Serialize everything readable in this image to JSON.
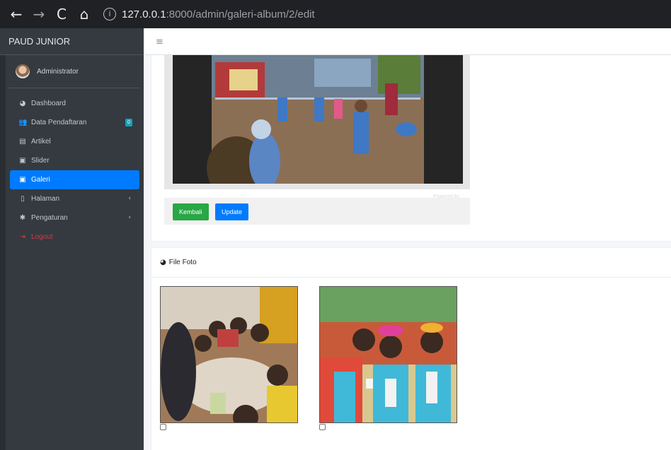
{
  "browser": {
    "back": "←",
    "forward": "→",
    "reload": "C",
    "home": "⌂",
    "info": "i",
    "url_host": "127.0.0.1",
    "url_path": ":8000/admin/galeri-album/2/edit"
  },
  "sidebar": {
    "brand": "PAUD JUNIOR",
    "user": "Administrator",
    "items": [
      {
        "label": "Dashboard",
        "icon": "tachometer-icon"
      },
      {
        "label": "Data Pendaftaran",
        "icon": "users-icon",
        "badge": "0"
      },
      {
        "label": "Artikel",
        "icon": "newspaper-icon"
      },
      {
        "label": "Slider",
        "icon": "images-icon"
      },
      {
        "label": "Galeri",
        "icon": "images-icon",
        "active": true
      },
      {
        "label": "Halaman",
        "icon": "file-icon",
        "chevron": "‹"
      },
      {
        "label": "Pengaturan",
        "icon": "cog-icon",
        "chevron": "‹"
      },
      {
        "label": "Logout",
        "icon": "sign-out-icon",
        "color": "#dc3545"
      }
    ]
  },
  "topbar": {
    "menu_icon": "≡"
  },
  "editor": {
    "powered_by": "Powered by FQINA",
    "back_label": "Kembali",
    "update_label": "Update"
  },
  "files": {
    "title": "File Foto",
    "photos": [
      {
        "alt": "children eating together"
      },
      {
        "alt": "children in blue uniforms with crowns"
      }
    ]
  },
  "colors": {
    "sidebar": "#343a40",
    "primary": "#007bff",
    "success": "#28a745",
    "danger": "#dc3545"
  }
}
